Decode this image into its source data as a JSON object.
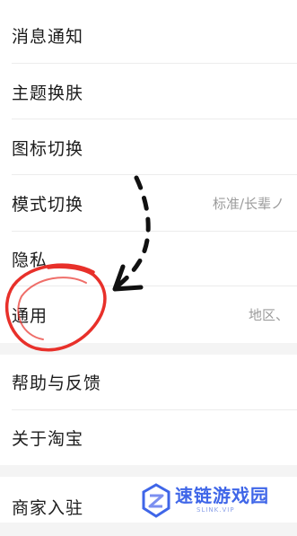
{
  "settings": {
    "items": [
      {
        "label": "消息通知",
        "value": ""
      },
      {
        "label": "主题换肤",
        "value": ""
      },
      {
        "label": "图标切换",
        "value": ""
      },
      {
        "label": "模式切换",
        "value": "标准/长辈ノ"
      },
      {
        "label": "隐私",
        "value": ""
      },
      {
        "label": "通用",
        "value": "地区、"
      },
      {
        "label": "帮助与反馈",
        "value": ""
      },
      {
        "label": "关于淘宝",
        "value": ""
      },
      {
        "label": "商家入驻",
        "value": ""
      }
    ]
  },
  "annotation": {
    "circle_color": "#e8302a",
    "arrow_color": "#111111"
  },
  "watermark": {
    "title": "速链游戏园",
    "subtitle": "SLINK.VIP",
    "color": "#3f66e8"
  }
}
